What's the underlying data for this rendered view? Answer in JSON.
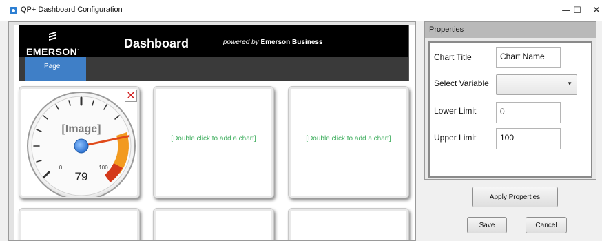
{
  "window": {
    "title": "QP+ Dashboard Configuration",
    "minimize_glyph": "—",
    "maximize_glyph": "☐",
    "close_glyph": "✕"
  },
  "header": {
    "logo_text": "EMERSON",
    "logo_tm": ".",
    "title": "Dashboard",
    "powered_by_prefix": "powered by",
    "powered_by_company": "Emerson Business"
  },
  "nav": {
    "items": [
      {
        "label": "Page"
      }
    ]
  },
  "tiles": {
    "gauge": {
      "image_label": "[Image]",
      "min_label": "0",
      "max_label": "100",
      "value": 79
    },
    "empty_hint": "[Double click to add a chart]"
  },
  "properties": {
    "header": "Properties",
    "chart_title_label": "Chart Title",
    "chart_title_value": "Chart Name",
    "select_variable_label": "Select Variable",
    "select_variable_value": "",
    "lower_limit_label": "Lower Limit",
    "lower_limit_value": "0",
    "upper_limit_label": "Upper Limit",
    "upper_limit_value": "100"
  },
  "buttons": {
    "apply": "Apply Properties",
    "save": "Save",
    "cancel": "Cancel"
  },
  "colors": {
    "accent_blue": "#3f7fc7",
    "hint_green": "#3fae5e",
    "close_red": "#d21f1f",
    "gauge_orange": "#f29a1f",
    "gauge_red": "#d4391b"
  },
  "icons": {
    "app": "app-icon",
    "delete": "close-icon"
  }
}
